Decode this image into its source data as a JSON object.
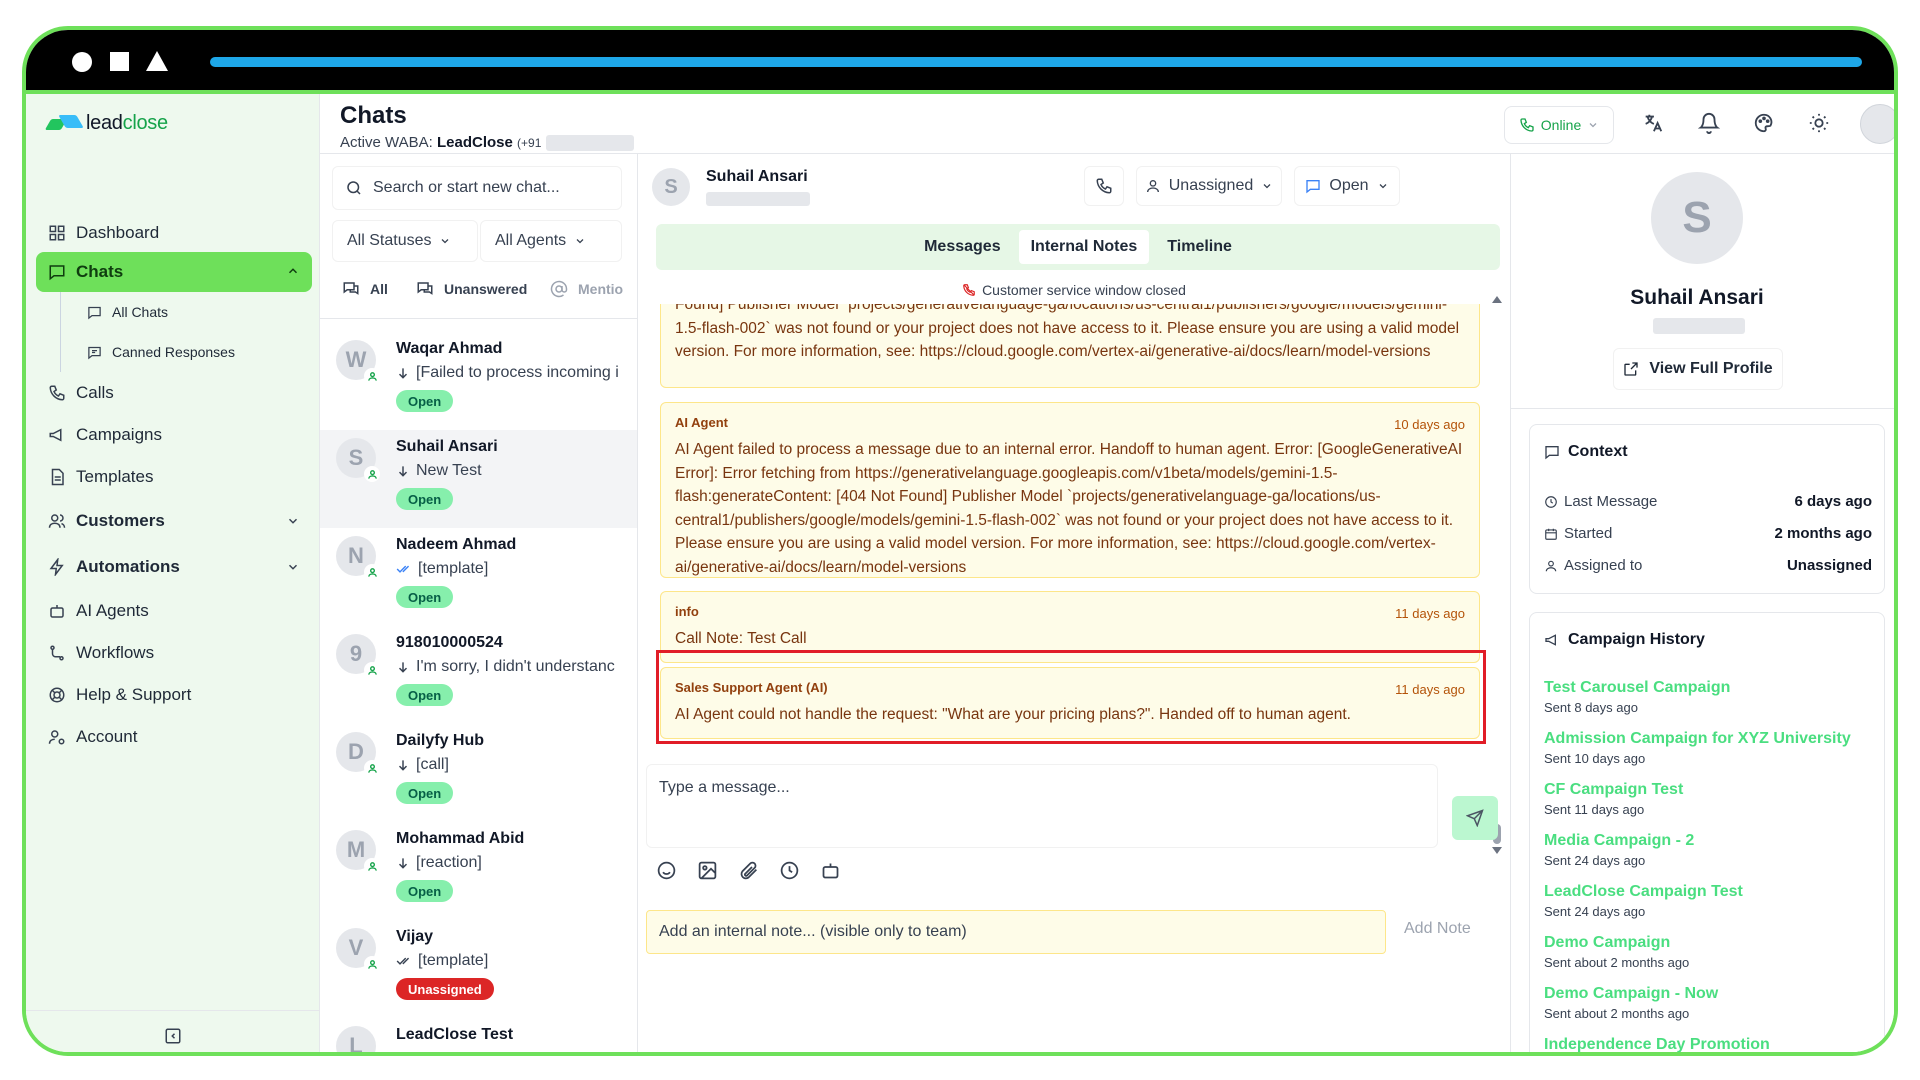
{
  "app": {
    "logo_text": "lead",
    "logo_accent": "close"
  },
  "sidebar": {
    "items": [
      {
        "label": "Dashboard"
      },
      {
        "label": "Chats"
      },
      {
        "label": "All Chats"
      },
      {
        "label": "Canned Responses"
      },
      {
        "label": "Calls"
      },
      {
        "label": "Campaigns"
      },
      {
        "label": "Templates"
      },
      {
        "label": "Customers"
      },
      {
        "label": "Automations"
      },
      {
        "label": "AI Agents"
      },
      {
        "label": "Workflows"
      },
      {
        "label": "Help & Support"
      },
      {
        "label": "Account"
      }
    ]
  },
  "header": {
    "title": "Chats",
    "waba_label": "Active WABA:",
    "waba_name": "LeadClose",
    "waba_phone": "(+91",
    "status": "Online"
  },
  "chatlist": {
    "search_placeholder": "Search or start new chat...",
    "filter_status": "All Statuses",
    "filter_agents": "All Agents",
    "quick_filters": [
      "All",
      "Unanswered",
      "Mentio"
    ],
    "chats": [
      {
        "initial": "W",
        "name": "Waqar Ahmad",
        "preview": "[Failed to process incoming i",
        "status": "Open"
      },
      {
        "initial": "S",
        "name": "Suhail Ansari",
        "preview": "New Test",
        "status": "Open"
      },
      {
        "initial": "N",
        "name": "Nadeem Ahmad",
        "preview": "[template]",
        "status": "Open"
      },
      {
        "initial": "9",
        "name": "918010000524",
        "preview": "I'm sorry, I didn't understanc",
        "status": "Open"
      },
      {
        "initial": "D",
        "name": "Dailyfy Hub",
        "preview": "[call]",
        "status": "Open"
      },
      {
        "initial": "M",
        "name": "Mohammad Abid",
        "preview": "[reaction]",
        "status": "Open"
      },
      {
        "initial": "V",
        "name": "Vijay",
        "preview": "[template]",
        "status": "Unassigned"
      },
      {
        "initial": "L",
        "name": "LeadClose Test",
        "preview": "",
        "status": ""
      }
    ]
  },
  "conversation": {
    "initial": "S",
    "name": "Suhail Ansari",
    "assign_label": "Unassigned",
    "status_label": "Open",
    "tabs": [
      "Messages",
      "Internal Notes",
      "Timeline"
    ],
    "active_tab": "Internal Notes",
    "window_notice": "Customer service window closed",
    "notes": [
      {
        "author": "",
        "time": "",
        "text": "Found] Publisher Model `projects/generativelanguage-ga/locations/us-central1/publishers/google/models/gemini-1.5-flash-002` was not found or your project does not have access to it. Please ensure you are using a valid model version. For more information, see: https://cloud.google.com/vertex-ai/generative-ai/docs/learn/model-versions"
      },
      {
        "author": "AI Agent",
        "time": "10 days ago",
        "text": "AI Agent failed to process a message due to an internal error. Handoff to human agent. Error: [GoogleGenerativeAI Error]: Error fetching from https://generativelanguage.googleapis.com/v1beta/models/gemini-1.5-flash:generateContent: [404 Not Found] Publisher Model `projects/generativelanguage-ga/locations/us-central1/publishers/google/models/gemini-1.5-flash-002` was not found or your project does not have access to it. Please ensure you are using a valid model version. For more information, see: https://cloud.google.com/vertex-ai/generative-ai/docs/learn/model-versions"
      },
      {
        "author": "info",
        "time": "11 days ago",
        "text": "Call Note: Test Call"
      },
      {
        "author": "Sales Support Agent (AI)",
        "time": "11 days ago",
        "text": "AI Agent could not handle the request: \"What are your pricing plans?\". Handed off to human agent."
      }
    ],
    "message_placeholder": "Type a message...",
    "note_placeholder": "Add an internal note... (visible only to team)",
    "add_note_label": "Add Note"
  },
  "profile": {
    "initial": "S",
    "name": "Suhail Ansari",
    "view_profile_label": "View Full Profile",
    "context_title": "Context",
    "context": [
      {
        "label": "Last Message",
        "value": "6 days ago"
      },
      {
        "label": "Started",
        "value": "2 months ago"
      },
      {
        "label": "Assigned to",
        "value": "Unassigned"
      }
    ],
    "campaign_title": "Campaign History",
    "campaigns": [
      {
        "name": "Test Carousel Campaign",
        "sent": "Sent 8 days ago"
      },
      {
        "name": "Admission Campaign for XYZ University",
        "sent": "Sent 10 days ago"
      },
      {
        "name": "CF Campaign Test",
        "sent": "Sent 11 days ago"
      },
      {
        "name": "Media Campaign - 2",
        "sent": "Sent 24 days ago"
      },
      {
        "name": "LeadClose Campaign Test",
        "sent": "Sent 24 days ago"
      },
      {
        "name": "Demo Campaign",
        "sent": "Sent about 2 months ago"
      },
      {
        "name": "Demo Campaign - Now",
        "sent": "Sent about 2 months ago"
      },
      {
        "name": "Independence Day Promotion",
        "sent": ""
      }
    ]
  },
  "colors": {
    "accent_green": "#6ee05a",
    "progress_blue": "#1ea7e8",
    "highlight_red": "#e11d27",
    "note_bg": "#fefce8"
  }
}
